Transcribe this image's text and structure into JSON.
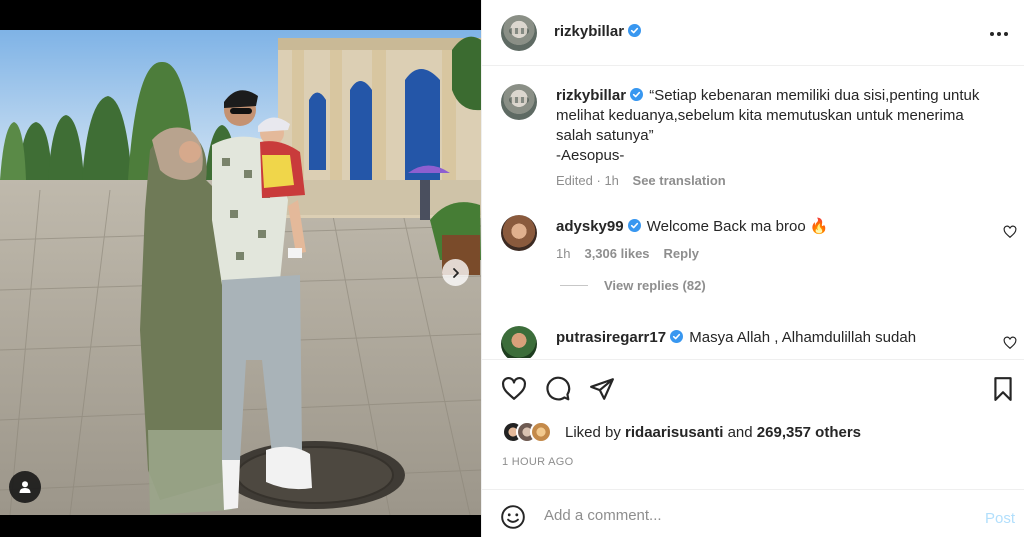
{
  "post": {
    "owner": "rizkybillar",
    "caption_lines": [
      "“Setiap kebenaran memiliki dua sisi,penting untuk",
      "melihat keduanya,sebelum kita memutuskan untuk menerima",
      "salah satunya”",
      "-Aesopus-"
    ],
    "caption_edited": "Edited",
    "caption_time": "1h",
    "see_translation": "See translation"
  },
  "comments": [
    {
      "user": "adysky99",
      "text": "Welcome Back ma broo",
      "emoji": "🔥",
      "time": "1h",
      "likes": "3,306 likes",
      "reply": "Reply",
      "view_replies": "View replies (82)"
    },
    {
      "user": "putrasiregarr17",
      "text": "Masya Allah , Alhamdulillah sudah"
    }
  ],
  "likes": {
    "prefix": "Liked by",
    "user": "ridaarisusanti",
    "connector": "and",
    "others": "269,357 others"
  },
  "time_ago": "1 HOUR AGO",
  "add_comment": {
    "placeholder": "Add a comment...",
    "post_label": "Post"
  },
  "icons": [
    "verified-badge-icon",
    "more-options-icon",
    "heart-icon",
    "comment-icon",
    "share-icon",
    "bookmark-icon",
    "emoji-icon",
    "chevron-right-icon",
    "user-tag-icon"
  ],
  "colors": {
    "verified": "#3897f0",
    "post_disabled": "#b2dffc",
    "muted_text": "#8e8e8e"
  }
}
